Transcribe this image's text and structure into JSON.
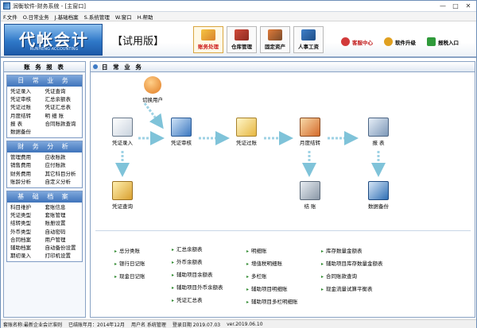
{
  "window": {
    "title": "润衡软件-财务系统 - [主窗口]"
  },
  "menu": [
    "F.文件",
    "O.日常业务",
    "J.基础档案",
    "S.系统管理",
    "W.窗口",
    "H.帮助"
  ],
  "banner": {
    "logo": "代帐会计",
    "logo_sub": "RUNHENG ACCOUNTING",
    "edition": "【试用版】",
    "modules": [
      {
        "label": "账务处理",
        "icon": "ledger-icon",
        "active": true
      },
      {
        "label": "仓库管理",
        "icon": "warehouse-icon",
        "active": false
      },
      {
        "label": "固定资产",
        "icon": "fixed-asset-icon",
        "active": false
      },
      {
        "label": "人事工资",
        "icon": "payroll-icon",
        "active": false
      }
    ],
    "links": [
      {
        "label": "客服中心",
        "icon": "customer-service-icon"
      },
      {
        "label": "软件升级",
        "icon": "upgrade-icon"
      },
      {
        "label": "报税入口",
        "icon": "tax-portal-icon"
      }
    ]
  },
  "sidebar": {
    "title": "账 务 报 表",
    "sections": [
      {
        "title": "日 常 业 务",
        "items": [
          "凭证录入",
          "凭证查询",
          "凭证审核",
          "汇总余额表",
          "凭证过账",
          "凭证汇总表",
          "月度结转",
          "明 细 账",
          "报 表",
          "合同账款查询",
          "数据备份"
        ]
      },
      {
        "title": "财 务 分 析",
        "items": [
          "管理费用",
          "应收账款",
          "销售费用",
          "应付账款",
          "财务费用",
          "其它科目分析",
          "账龄分析",
          "自定义分析"
        ]
      },
      {
        "title": "基 础 档 案",
        "items": [
          "科目维护",
          "套账信息",
          "凭证类型",
          "套账管理",
          "结转类型",
          "账册设置",
          "外币类型",
          "自动密码",
          "合同档案",
          "用户管理",
          "辅助档案",
          "自动备份设置",
          "期初录入",
          "打印机设置"
        ]
      }
    ]
  },
  "main": {
    "title": "日 常 业 务",
    "flow": {
      "switch_user": "切换用户",
      "entry": "凭证录入",
      "audit": "凭证审核",
      "posting": "凭证过账",
      "monthly": "月度结转",
      "report": "报 表",
      "query": "凭证查询",
      "closing": "结 账",
      "backup": "数据备份"
    },
    "links": [
      [
        "总分类账",
        "银行日记账",
        "现金日记账"
      ],
      [
        "汇总余额表",
        "外币余额表",
        "辅助项目余额表",
        "辅助项目外币余额表",
        "凭证汇总表"
      ],
      [
        "明细账",
        "增值税明细账",
        "多栏账",
        "辅助项目明细账",
        "辅助项目多栏明细账"
      ],
      [
        "库存数量金额表",
        "辅助项目库存数量金额表",
        "合同账款查询",
        "现金流量试算平衡表"
      ]
    ]
  },
  "status": {
    "account": "套账名称:最新企业会计准则",
    "period": "已结账年月：2014年12月",
    "user": "用户名  系统管理",
    "login": "登录日期 2019.07.03",
    "version": "ver.2019.06.10"
  }
}
